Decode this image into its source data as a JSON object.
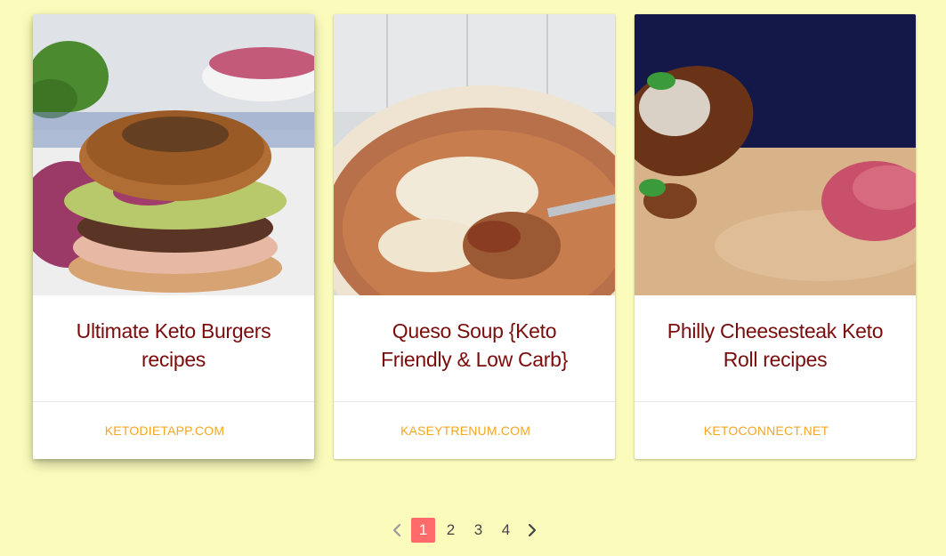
{
  "cards": [
    {
      "title": "Ultimate Keto Burgers recipes",
      "source": "KETODIETAPP.COM",
      "image_alt": "keto burger with coleslaw"
    },
    {
      "title": "Queso Soup {Keto Friendly & Low Carb}",
      "source": "KASEYTRENUM.COM",
      "image_alt": "bowl of queso soup with shredded cheese"
    },
    {
      "title": "Philly Cheesesteak Keto Roll recipes",
      "source": "KETOCONNECT.NET",
      "image_alt": "philly cheesesteak keto roll on cutting board"
    }
  ],
  "pagination": {
    "prev_icon": "chevron-left-icon",
    "next_icon": "chevron-right-icon",
    "pages": [
      "1",
      "2",
      "3",
      "4"
    ],
    "current": "1"
  },
  "colors": {
    "background": "#fbfcbc",
    "title": "#7a0c0c",
    "source": "#f5a623",
    "active_page": "#ff6b6b"
  }
}
